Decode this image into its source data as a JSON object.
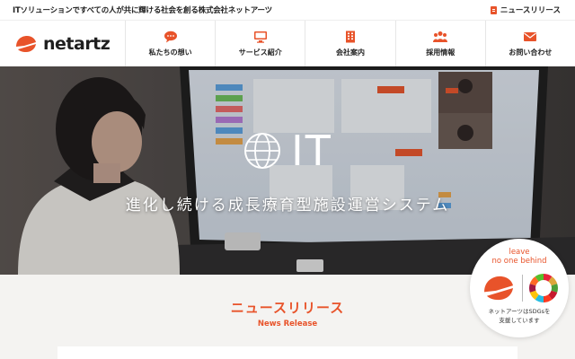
{
  "topbar": {
    "tagline": "ITソリューションですべての人が共に輝ける社会を創る株式会社ネットアーツ",
    "news_link": "ニュースリリース",
    "news_icon": "document-icon"
  },
  "header": {
    "logo_text": "netartz",
    "brand_color": "#e8532a",
    "nav": [
      {
        "label": "私たちの想い",
        "icon": "speech-bubble-icon"
      },
      {
        "label": "サービス紹介",
        "icon": "monitor-icon"
      },
      {
        "label": "会社案内",
        "icon": "building-icon"
      },
      {
        "label": "採用情報",
        "icon": "people-icon"
      },
      {
        "label": "お問い合わせ",
        "icon": "mail-icon"
      }
    ]
  },
  "hero": {
    "title": "IT",
    "subtitle": "進化し続ける成長療育型施設運営システム"
  },
  "news": {
    "title": "ニュースリリース",
    "subtitle": "News Release"
  },
  "sdgs": {
    "line1": "leave",
    "line2": "no one behind",
    "caption1": "ネットアーツはSDGsを",
    "caption2": "支援しています"
  }
}
